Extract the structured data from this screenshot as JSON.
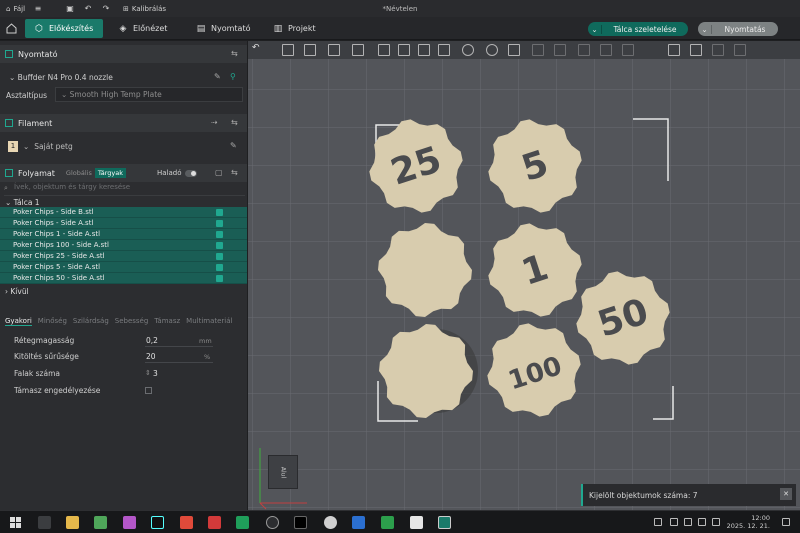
{
  "titlebar": {
    "file_label": "Fájl",
    "menu_label": "≡",
    "calibration_label": "Kalibrálás",
    "document_title": "*Névtelen"
  },
  "tabs": [
    {
      "label": "Előkészítés",
      "active": true
    },
    {
      "label": "Előnézet",
      "active": false
    },
    {
      "label": "Nyomtató",
      "active": false
    },
    {
      "label": "Projekt",
      "active": false
    }
  ],
  "actions": {
    "slice_label": "Tálca szeletelése",
    "print_label": "Nyomtatás"
  },
  "printer": {
    "section_title": "Nyomtató",
    "name": "Buffder N4 Pro 0.4 nozzle",
    "plate_label": "Asztaltípus",
    "plate_value": "Smooth High Temp Plate"
  },
  "filament": {
    "section_title": "Filament",
    "slot_number": "1",
    "name": "Saját petg"
  },
  "process": {
    "section_title": "Folyamat",
    "scope_global": "Globális",
    "scope_objects": "Tárgyak",
    "advanced_label": "Haladó",
    "search_placeholder": "Ívek, objektum és tárgy keresése"
  },
  "objects": {
    "plate_label": "Tálca 1",
    "items": [
      "Poker Chips - Side B.stl",
      "Poker Chips - Side A.stl",
      "Poker Chips 1 - Side A.stl",
      "Poker Chips 100 - Side A.stl",
      "Poker Chips 25 - Side A.stl",
      "Poker Chips 5 - Side A.stl",
      "Poker Chips 50 - Side A.stl"
    ],
    "outside_label": "Kívül"
  },
  "settings_tabs": [
    "Gyakori",
    "Minőség",
    "Szilárdság",
    "Sebesség",
    "Támasz",
    "Multimateriál"
  ],
  "settings": [
    {
      "label": "Rétegmagasság",
      "value": "0,2",
      "unit": "mm"
    },
    {
      "label": "Kitöltés sűrűsége",
      "value": "20",
      "unit": "%"
    },
    {
      "label": "Falak száma",
      "value": "3",
      "unit": ""
    },
    {
      "label": "Támasz engedélyezése",
      "value": "",
      "unit": ""
    }
  ],
  "viewport": {
    "chip_labels": [
      "25",
      "5",
      "1",
      "50",
      "100"
    ],
    "axis_label": "Alul"
  },
  "notification": {
    "text": "Kijelölt objektumok száma: 7"
  },
  "taskbar": {
    "time": "12:00",
    "date": "2025. 12. 21."
  },
  "colors": {
    "accent": "#1a7a6a",
    "chip": "#d8ccae",
    "plate": "#53555a"
  }
}
